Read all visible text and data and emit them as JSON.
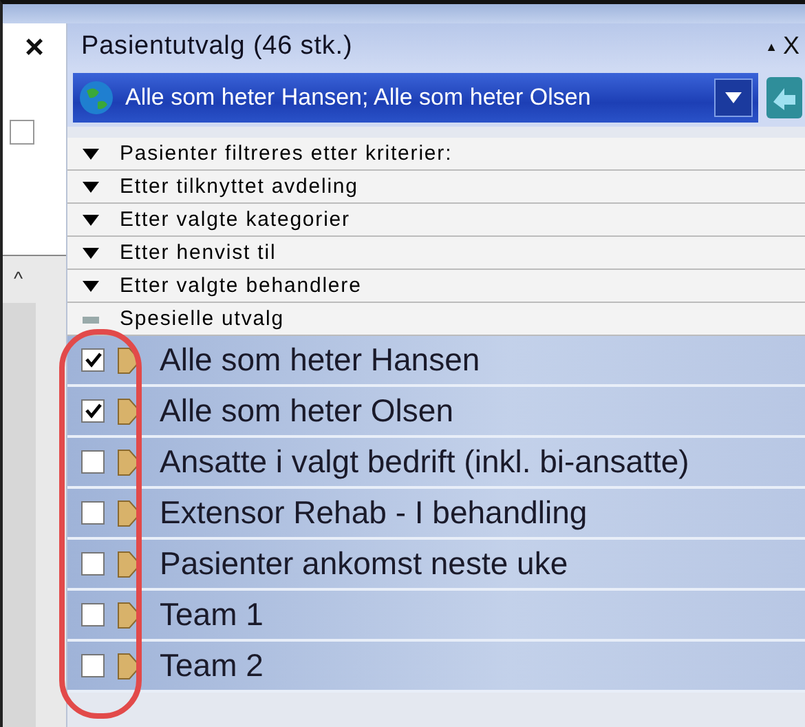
{
  "side_panel": {
    "close": "×",
    "scroll_up": "^",
    "checked": false
  },
  "panel": {
    "title": "Pasientutvalg (46 stk.)",
    "pin": "▲",
    "close": "X"
  },
  "selection": {
    "value": "Alle som heter Hansen; Alle som heter Olsen"
  },
  "sections": [
    {
      "label": "Pasienter filtreres etter kriterier:",
      "expanded": false
    },
    {
      "label": "Etter tilknyttet avdeling",
      "expanded": false
    },
    {
      "label": "Etter valgte kategorier",
      "expanded": false
    },
    {
      "label": "Etter henvist til",
      "expanded": false
    },
    {
      "label": "Etter valgte behandlere",
      "expanded": false
    },
    {
      "label": "Spesielle utvalg",
      "expanded": true
    }
  ],
  "items": [
    {
      "label": "Alle som heter Hansen",
      "checked": true
    },
    {
      "label": "Alle som heter Olsen",
      "checked": true
    },
    {
      "label": "Ansatte i valgt bedrift (inkl. bi-ansatte)",
      "checked": false
    },
    {
      "label": "Extensor Rehab - I behandling",
      "checked": false
    },
    {
      "label": "Pasienter ankomst neste uke",
      "checked": false
    },
    {
      "label": "Team 1",
      "checked": false
    },
    {
      "label": "Team 2",
      "checked": false
    }
  ]
}
